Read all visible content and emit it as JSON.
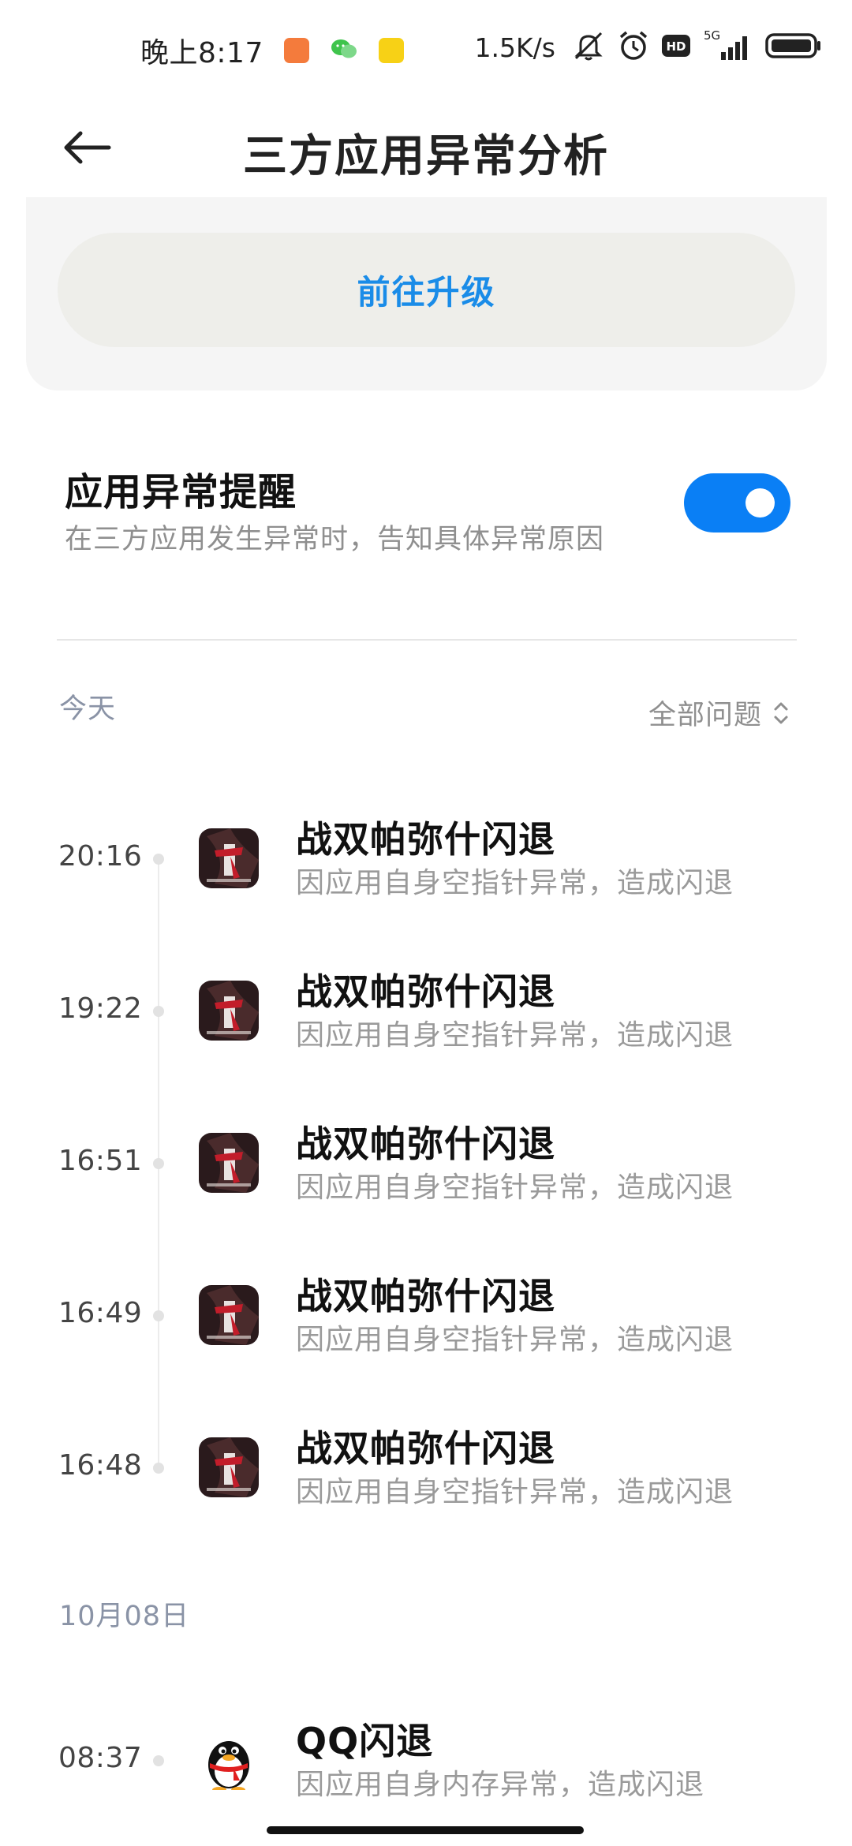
{
  "status_bar": {
    "time": "晚上8:17",
    "net_speed": "1.5K/s",
    "network_type": "5G",
    "icons": [
      "shopping-app-icon",
      "wechat-icon",
      "yellow-app-icon",
      "mute-icon",
      "alarm-icon",
      "hd-icon",
      "signal-icon",
      "battery-icon"
    ]
  },
  "header": {
    "title": "三方应用异常分析",
    "back_icon": "back-arrow-icon"
  },
  "upgrade": {
    "button_label": "前往升级",
    "accent_color": "#1a8ce8"
  },
  "setting": {
    "title": "应用异常提醒",
    "description": "在三方应用发生异常时，告知具体异常原因",
    "toggle_on": true,
    "toggle_color": "#0a7ff5"
  },
  "filter": {
    "date_label": "今天",
    "filter_label": "全部问题",
    "filter_icon": "updown-chevron-icon"
  },
  "today_entries": [
    {
      "time": "20:16",
      "title": "战双帕弥什闪退",
      "desc": "因应用自身空指针异常，造成闪退",
      "icon": "punishing-game-icon"
    },
    {
      "time": "19:22",
      "title": "战双帕弥什闪退",
      "desc": "因应用自身空指针异常，造成闪退",
      "icon": "punishing-game-icon"
    },
    {
      "time": "16:51",
      "title": "战双帕弥什闪退",
      "desc": "因应用自身空指针异常，造成闪退",
      "icon": "punishing-game-icon"
    },
    {
      "time": "16:49",
      "title": "战双帕弥什闪退",
      "desc": "因应用自身空指针异常，造成闪退",
      "icon": "punishing-game-icon"
    },
    {
      "time": "16:48",
      "title": "战双帕弥什闪退",
      "desc": "因应用自身空指针异常，造成闪退",
      "icon": "punishing-game-icon"
    }
  ],
  "earlier_section": {
    "date_label": "10月08日",
    "entries": [
      {
        "time": "08:37",
        "title": "QQ闪退",
        "desc": "因应用自身内存异常，造成闪退",
        "icon": "qq-penguin-icon"
      }
    ]
  }
}
